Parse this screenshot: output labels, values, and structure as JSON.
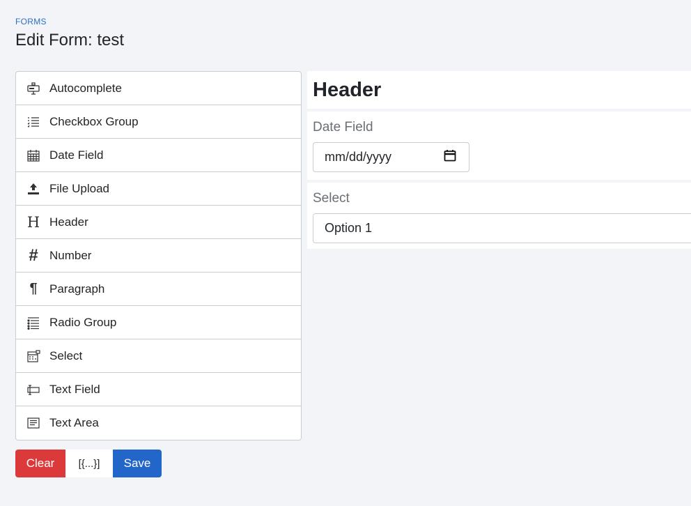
{
  "breadcrumb": "FORMS",
  "page_title": "Edit Form: test",
  "controls": [
    {
      "label": "Autocomplete",
      "icon": "autocomplete-icon"
    },
    {
      "label": "Checkbox Group",
      "icon": "checkbox-group-icon"
    },
    {
      "label": "Date Field",
      "icon": "calendar-icon"
    },
    {
      "label": "File Upload",
      "icon": "upload-icon"
    },
    {
      "label": "Header",
      "icon": "header-icon"
    },
    {
      "label": "Number",
      "icon": "hash-icon"
    },
    {
      "label": "Paragraph",
      "icon": "paragraph-icon"
    },
    {
      "label": "Radio Group",
      "icon": "radio-group-icon"
    },
    {
      "label": "Select",
      "icon": "select-icon"
    },
    {
      "label": "Text Field",
      "icon": "text-field-icon"
    },
    {
      "label": "Text Area",
      "icon": "text-area-icon"
    }
  ],
  "actions": {
    "clear_label": "Clear",
    "json_label": "[{...}]",
    "save_label": "Save"
  },
  "stage": {
    "header_text": "Header",
    "date_field": {
      "label": "Date Field",
      "placeholder": "mm/dd/yyyy"
    },
    "select_field": {
      "label": "Select",
      "selected": "Option 1"
    }
  },
  "colors": {
    "accent": "#2366c9",
    "danger": "#dc3a3a",
    "background": "#f3f4f8"
  }
}
